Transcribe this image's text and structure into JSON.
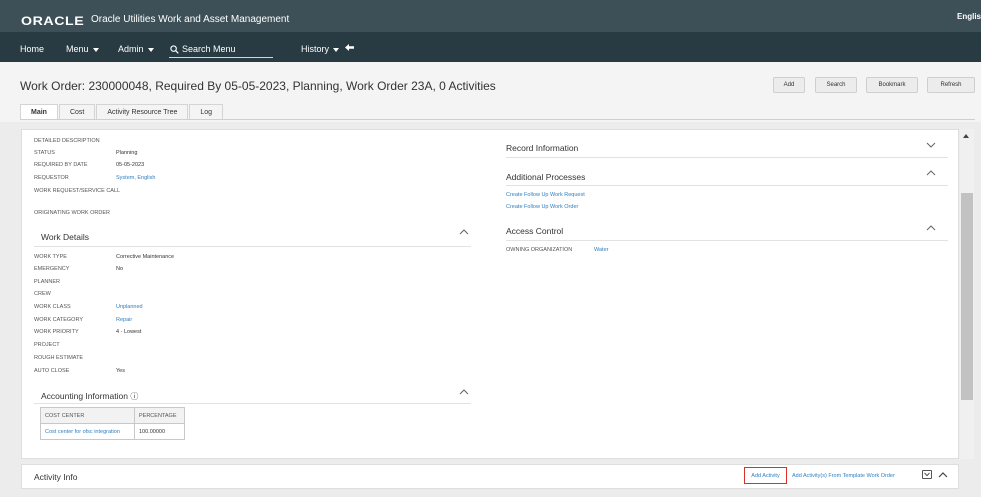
{
  "brand": {
    "logo": "ORACLE",
    "app_title": "Oracle Utilities Work and Asset Management",
    "language": "English"
  },
  "menu": {
    "home": "Home",
    "menu": "Menu",
    "admin": "Admin",
    "search": "Search Menu",
    "history": "History"
  },
  "header": {
    "title": "Work Order: 230000048, Required By 05-05-2023, Planning, Work Order 23A, 0 Activities",
    "buttons": {
      "add": "Add",
      "search": "Search",
      "bookmark": "Bookmark",
      "refresh": "Refresh"
    },
    "tabs": [
      "Main",
      "Cost",
      "Activity Resource Tree",
      "Log"
    ]
  },
  "main": {
    "fields": [
      {
        "label": "DETAILED DESCRIPTION",
        "value": ""
      },
      {
        "label": "STATUS",
        "value": "Planning"
      },
      {
        "label": "REQUIRED BY DATE",
        "value": "05-05-2023"
      },
      {
        "label": "REQUESTOR",
        "value": "System, English"
      },
      {
        "label": "WORK REQUEST/SERVICE CALL",
        "value": ""
      },
      {
        "label": "ORIGINATING WORK ORDER",
        "value": ""
      }
    ],
    "work_details": {
      "title": "Work Details",
      "fields": [
        {
          "label": "WORK TYPE",
          "value": "Corrective Maintenance"
        },
        {
          "label": "EMERGENCY",
          "value": "No"
        },
        {
          "label": "PLANNER",
          "value": ""
        },
        {
          "label": "CREW",
          "value": ""
        },
        {
          "label": "WORK CLASS",
          "value": "Unplanned"
        },
        {
          "label": "WORK CATEGORY",
          "value": "Repair"
        },
        {
          "label": "WORK PRIORITY",
          "value": "4 - Lowest"
        },
        {
          "label": "PROJECT",
          "value": ""
        },
        {
          "label": "ROUGH ESTIMATE",
          "value": ""
        },
        {
          "label": "AUTO CLOSE",
          "value": "Yes"
        }
      ]
    },
    "accounting": {
      "title": "Accounting Information",
      "columns": [
        "COST CENTER",
        "PERCENTAGE"
      ],
      "rows": [
        [
          "Cost center for ofsc integration",
          "100.00000"
        ]
      ]
    },
    "record_info": {
      "title": "Record Information"
    },
    "additional_processes": {
      "title": "Additional Processes",
      "links": [
        "Create Follow Up Work Request",
        "Create Follow Up Work Order"
      ]
    },
    "access_control": {
      "title": "Access Control",
      "label": "OWNING ORGANIZATION",
      "value": "Water"
    }
  },
  "activity_info": {
    "title": "Activity Info",
    "add_activity": "Add Activity",
    "add_from_template": "Add Activity(s) From Template Work Order"
  },
  "colors": {
    "brand_bar": "#3d5057",
    "menu_bar": "#283a42",
    "link": "#2f7fc1",
    "highlight": "#d9302a"
  }
}
